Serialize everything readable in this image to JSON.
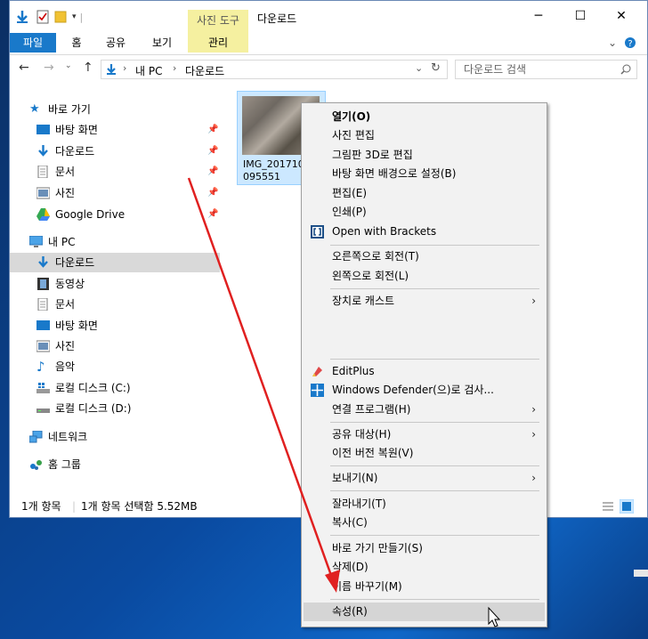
{
  "window": {
    "title": "다운로드",
    "context_tab": "사진 도구",
    "context_sub_tab": "관리",
    "tabs": [
      "파일",
      "홈",
      "공유",
      "보기"
    ]
  },
  "address": {
    "crumbs": [
      "내 PC",
      "다운로드"
    ],
    "search_placeholder": "다운로드 검색"
  },
  "nav": {
    "quick_access": "바로 가기",
    "pinned": [
      "바탕 화면",
      "다운로드",
      "문서",
      "사진",
      "Google Drive"
    ],
    "this_pc": "내 PC",
    "pc_items": [
      "다운로드",
      "동영상",
      "문서",
      "바탕 화면",
      "사진",
      "음악",
      "로컬 디스크 (C:)",
      "로컬 디스크 (D:)"
    ],
    "network": "네트워크",
    "homegroup": "홈 그룹"
  },
  "file": {
    "name_line1": "IMG_201710",
    "name_line2": "095551"
  },
  "status": {
    "count": "1개 항목",
    "selection": "1개 항목 선택함 5.52MB"
  },
  "menu": {
    "items": [
      "열기(O)",
      "사진 편집",
      "그림판 3D로 편집",
      "바탕 화면 배경으로 설정(B)",
      "편집(E)",
      "인쇄(P)",
      "Open with Brackets",
      "오른쪽으로 회전(T)",
      "왼쪽으로 회전(L)",
      "장치로 캐스트",
      "EditPlus",
      "Windows Defender(으)로 검사...",
      "연결 프로그램(H)",
      "공유 대상(H)",
      "이전 버전 복원(V)",
      "보내기(N)",
      "잘라내기(T)",
      "복사(C)",
      "바로 가기 만들기(S)",
      "삭제(D)",
      "이름 바꾸기(M)",
      "속성(R)"
    ]
  },
  "colors": {
    "accent": "#1979ca",
    "arrow": "#e02020",
    "ribbon_context": "#f5f0a0"
  }
}
